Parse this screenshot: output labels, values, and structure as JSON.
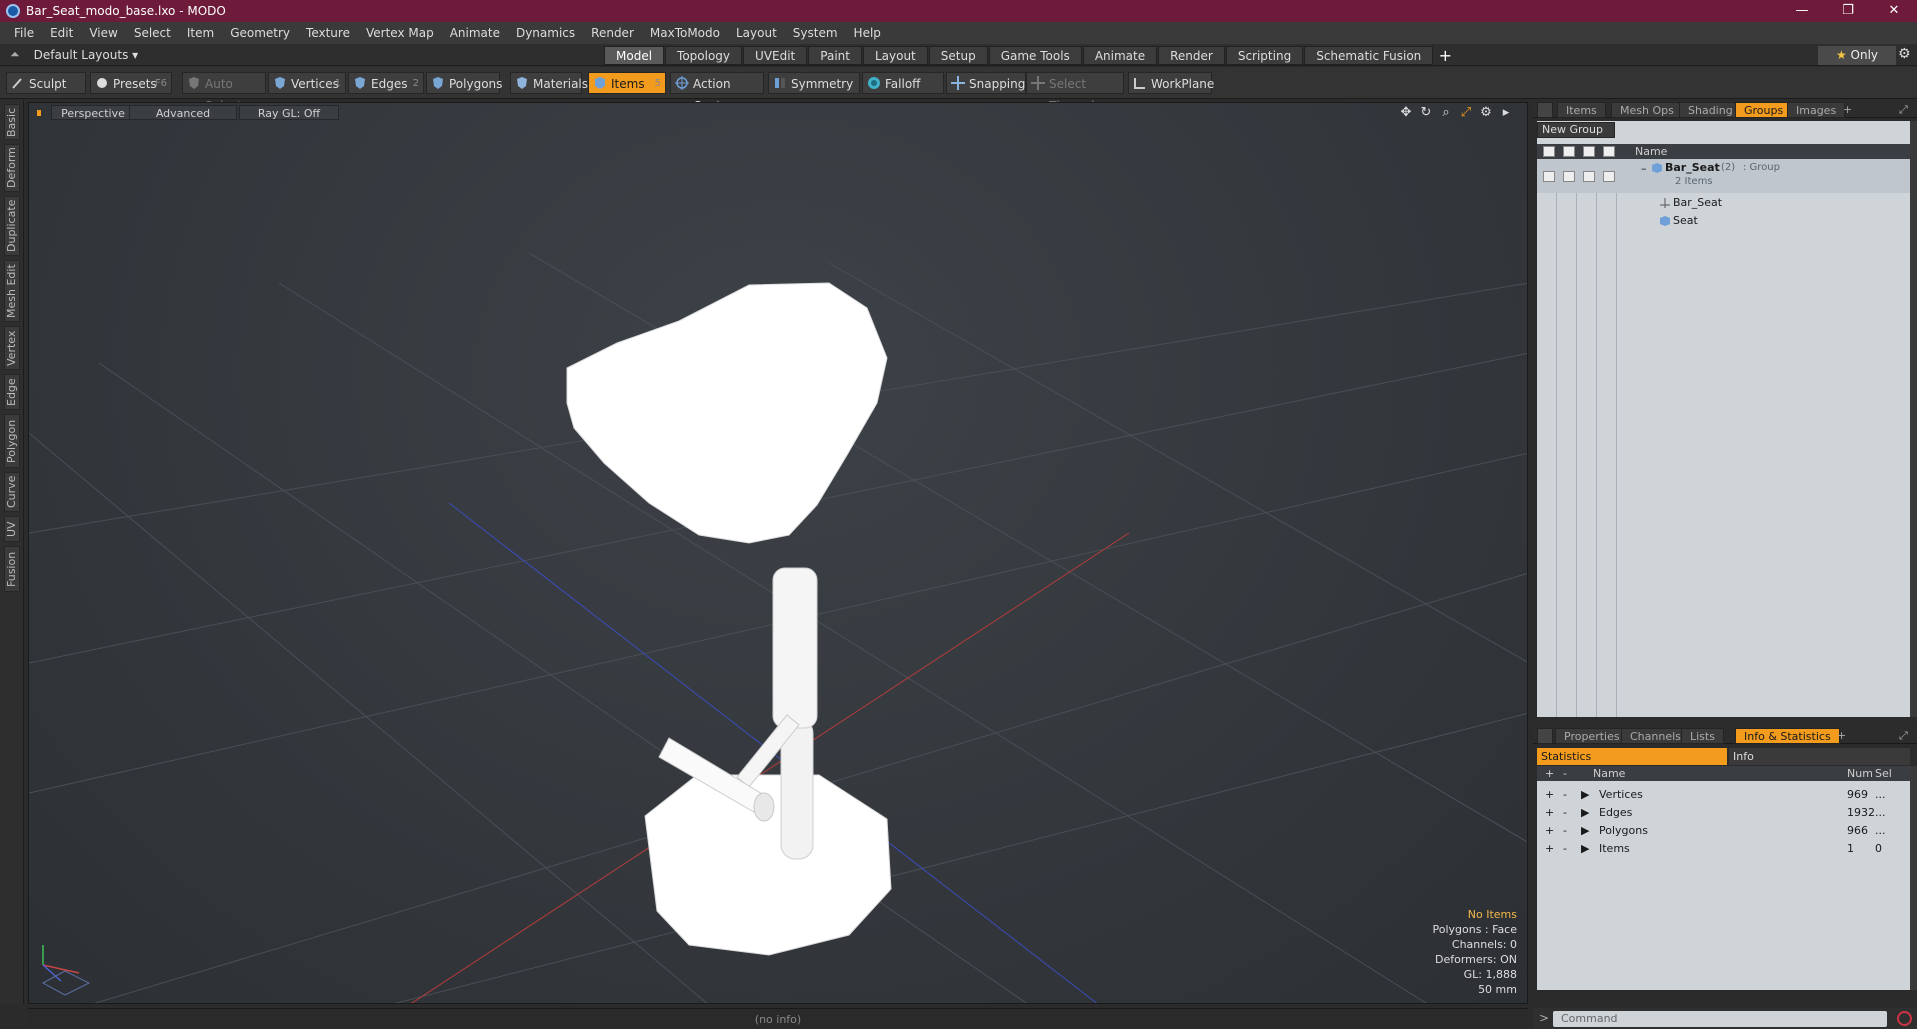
{
  "window": {
    "title": "Bar_Seat_modo_base.lxo - MODO",
    "controls": [
      "—",
      "❐",
      "✕"
    ]
  },
  "menu": [
    "File",
    "Edit",
    "View",
    "Select",
    "Item",
    "Geometry",
    "Texture",
    "Vertex Map",
    "Animate",
    "Dynamics",
    "Render",
    "MaxToModo",
    "Layout",
    "System",
    "Help"
  ],
  "modebar": {
    "layouts_label": "Default Layouts ▾",
    "tabs": [
      "Model",
      "Topology",
      "UVEdit",
      "Paint",
      "Layout",
      "Setup",
      "Game Tools",
      "Animate",
      "Render",
      "Scripting",
      "Schematic Fusion"
    ],
    "active_tab": "Model",
    "plus": "+",
    "only_star": "★",
    "only_label": "Only"
  },
  "toolbar": {
    "sculpt": "Sculpt",
    "presets": "Presets",
    "presets_key": "F6",
    "auto_select": "Auto Select",
    "vertices": "Vertices",
    "vertices_key": "1",
    "edges": "Edges",
    "edges_key": "2",
    "polygons": "Polygons",
    "materials": "Materials",
    "items": "Items",
    "items_key": "5",
    "action_center": "Action Center",
    "symmetry": "Symmetry",
    "falloff": "Falloff",
    "snapping": "Snapping",
    "select_through": "Select Through",
    "workplane": "WorkPlane"
  },
  "left_tabs": [
    "Basic",
    "Deform",
    "Duplicate",
    "Mesh Edit",
    "Vertex",
    "Edge",
    "Polygon",
    "Curve",
    "UV",
    "Fusion"
  ],
  "viewport": {
    "perspective": "Perspective",
    "advanced": "Advanced",
    "raygl": "Ray GL: Off",
    "info": {
      "no_items": "No Items",
      "polygons": "Polygons : Face",
      "channels": "Channels: 0",
      "deformers": "Deformers: ON",
      "gl": "GL: 1,888",
      "scale": "50 mm"
    }
  },
  "status": "(no info)",
  "groups_panel": {
    "tabs": [
      "Items",
      "Mesh Ops",
      "Shading",
      "Groups",
      "Images"
    ],
    "active_tab": "Groups",
    "plus": "+",
    "new_group": "New Group",
    "column_name": "Name",
    "tree": {
      "group_name": "Bar_Seat",
      "group_count": "(2)",
      "group_type": ": Group",
      "group_sub": "2 Items",
      "children": [
        "Bar_Seat",
        "Seat"
      ]
    }
  },
  "stats_panel": {
    "tabs": [
      "Properties",
      "Channels",
      "Lists",
      "Info & Statistics"
    ],
    "active_tab": "Info & Statistics",
    "plus": "+",
    "sub_tabs": [
      "Statistics",
      "Info"
    ],
    "columns": {
      "name": "Name",
      "num": "Num",
      "sel": "Sel"
    },
    "rows": [
      {
        "name": "Vertices",
        "num": "969",
        "sel": "..."
      },
      {
        "name": "Edges",
        "num": "1932",
        "sel": "..."
      },
      {
        "name": "Polygons",
        "num": "966",
        "sel": "..."
      },
      {
        "name": "Items",
        "num": "1",
        "sel": "0"
      }
    ]
  },
  "command": {
    "prompt": ">",
    "placeholder": "Command"
  },
  "colors": {
    "accent": "#f29b1d",
    "titlebar": "#6e1a3a",
    "axis_x": "#c23b3b",
    "axis_z": "#3b4fc2"
  }
}
